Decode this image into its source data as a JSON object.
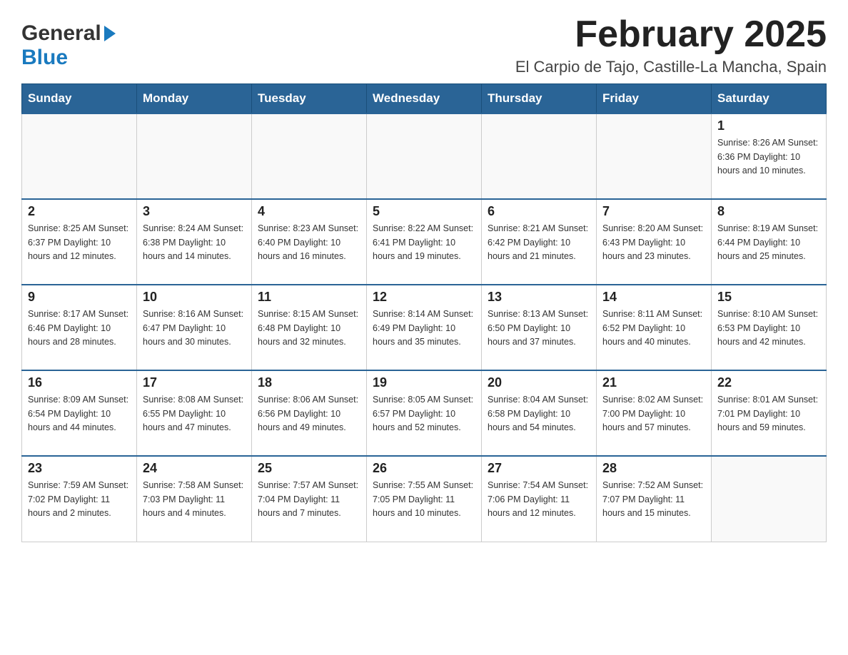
{
  "logo": {
    "line1": "General",
    "line2": "Blue"
  },
  "title": "February 2025",
  "subtitle": "El Carpio de Tajo, Castille-La Mancha, Spain",
  "days_of_week": [
    "Sunday",
    "Monday",
    "Tuesday",
    "Wednesday",
    "Thursday",
    "Friday",
    "Saturday"
  ],
  "weeks": [
    [
      {
        "day": "",
        "info": ""
      },
      {
        "day": "",
        "info": ""
      },
      {
        "day": "",
        "info": ""
      },
      {
        "day": "",
        "info": ""
      },
      {
        "day": "",
        "info": ""
      },
      {
        "day": "",
        "info": ""
      },
      {
        "day": "1",
        "info": "Sunrise: 8:26 AM\nSunset: 6:36 PM\nDaylight: 10 hours\nand 10 minutes."
      }
    ],
    [
      {
        "day": "2",
        "info": "Sunrise: 8:25 AM\nSunset: 6:37 PM\nDaylight: 10 hours\nand 12 minutes."
      },
      {
        "day": "3",
        "info": "Sunrise: 8:24 AM\nSunset: 6:38 PM\nDaylight: 10 hours\nand 14 minutes."
      },
      {
        "day": "4",
        "info": "Sunrise: 8:23 AM\nSunset: 6:40 PM\nDaylight: 10 hours\nand 16 minutes."
      },
      {
        "day": "5",
        "info": "Sunrise: 8:22 AM\nSunset: 6:41 PM\nDaylight: 10 hours\nand 19 minutes."
      },
      {
        "day": "6",
        "info": "Sunrise: 8:21 AM\nSunset: 6:42 PM\nDaylight: 10 hours\nand 21 minutes."
      },
      {
        "day": "7",
        "info": "Sunrise: 8:20 AM\nSunset: 6:43 PM\nDaylight: 10 hours\nand 23 minutes."
      },
      {
        "day": "8",
        "info": "Sunrise: 8:19 AM\nSunset: 6:44 PM\nDaylight: 10 hours\nand 25 minutes."
      }
    ],
    [
      {
        "day": "9",
        "info": "Sunrise: 8:17 AM\nSunset: 6:46 PM\nDaylight: 10 hours\nand 28 minutes."
      },
      {
        "day": "10",
        "info": "Sunrise: 8:16 AM\nSunset: 6:47 PM\nDaylight: 10 hours\nand 30 minutes."
      },
      {
        "day": "11",
        "info": "Sunrise: 8:15 AM\nSunset: 6:48 PM\nDaylight: 10 hours\nand 32 minutes."
      },
      {
        "day": "12",
        "info": "Sunrise: 8:14 AM\nSunset: 6:49 PM\nDaylight: 10 hours\nand 35 minutes."
      },
      {
        "day": "13",
        "info": "Sunrise: 8:13 AM\nSunset: 6:50 PM\nDaylight: 10 hours\nand 37 minutes."
      },
      {
        "day": "14",
        "info": "Sunrise: 8:11 AM\nSunset: 6:52 PM\nDaylight: 10 hours\nand 40 minutes."
      },
      {
        "day": "15",
        "info": "Sunrise: 8:10 AM\nSunset: 6:53 PM\nDaylight: 10 hours\nand 42 minutes."
      }
    ],
    [
      {
        "day": "16",
        "info": "Sunrise: 8:09 AM\nSunset: 6:54 PM\nDaylight: 10 hours\nand 44 minutes."
      },
      {
        "day": "17",
        "info": "Sunrise: 8:08 AM\nSunset: 6:55 PM\nDaylight: 10 hours\nand 47 minutes."
      },
      {
        "day": "18",
        "info": "Sunrise: 8:06 AM\nSunset: 6:56 PM\nDaylight: 10 hours\nand 49 minutes."
      },
      {
        "day": "19",
        "info": "Sunrise: 8:05 AM\nSunset: 6:57 PM\nDaylight: 10 hours\nand 52 minutes."
      },
      {
        "day": "20",
        "info": "Sunrise: 8:04 AM\nSunset: 6:58 PM\nDaylight: 10 hours\nand 54 minutes."
      },
      {
        "day": "21",
        "info": "Sunrise: 8:02 AM\nSunset: 7:00 PM\nDaylight: 10 hours\nand 57 minutes."
      },
      {
        "day": "22",
        "info": "Sunrise: 8:01 AM\nSunset: 7:01 PM\nDaylight: 10 hours\nand 59 minutes."
      }
    ],
    [
      {
        "day": "23",
        "info": "Sunrise: 7:59 AM\nSunset: 7:02 PM\nDaylight: 11 hours\nand 2 minutes."
      },
      {
        "day": "24",
        "info": "Sunrise: 7:58 AM\nSunset: 7:03 PM\nDaylight: 11 hours\nand 4 minutes."
      },
      {
        "day": "25",
        "info": "Sunrise: 7:57 AM\nSunset: 7:04 PM\nDaylight: 11 hours\nand 7 minutes."
      },
      {
        "day": "26",
        "info": "Sunrise: 7:55 AM\nSunset: 7:05 PM\nDaylight: 11 hours\nand 10 minutes."
      },
      {
        "day": "27",
        "info": "Sunrise: 7:54 AM\nSunset: 7:06 PM\nDaylight: 11 hours\nand 12 minutes."
      },
      {
        "day": "28",
        "info": "Sunrise: 7:52 AM\nSunset: 7:07 PM\nDaylight: 11 hours\nand 15 minutes."
      },
      {
        "day": "",
        "info": ""
      }
    ]
  ]
}
